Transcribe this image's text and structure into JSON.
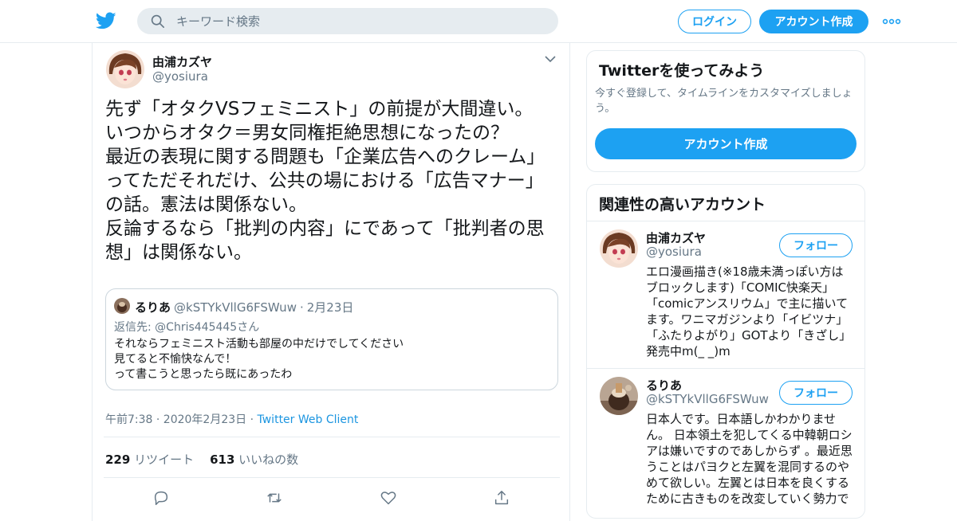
{
  "header": {
    "search_placeholder": "キーワード検索",
    "login_label": "ログイン",
    "signup_label": "アカウント作成",
    "brand_color": "#1da1f2"
  },
  "tweet": {
    "author_name": "由浦カズヤ",
    "author_handle": "@yosiura",
    "text_lines": [
      "先ず「オタクVSフェミニスト」の前提が大間違い。",
      "いつからオタク＝男女同権拒絶思想になったの？",
      "最近の表現に関する問題も「企業広告へのクレーム」",
      "ってただそれだけ、公共の場における「広告マナー」",
      "の話。憲法は関係ない。",
      "反論するなら「批判の内容」にであって「批判者の思",
      "想」は関係ない。"
    ],
    "quote": {
      "name": "るりあ",
      "handle": "@kSTYkVllG6FSWuw",
      "dot": "·",
      "date": "2月23日",
      "reply_prefix": "返信先: ",
      "reply_mention": "@Chris445445さん",
      "body_lines": [
        "それならフェミニスト活動も部屋の中だけでしてください",
        "見てると不愉快なんで！",
        "って書こうと思ったら既にあったわ"
      ]
    },
    "timestamp": "午前7:38 · 2020年2月23日 · ",
    "client": "Twitter Web Client",
    "retweet_count": "229",
    "retweet_label": " リツイート",
    "like_count": "613",
    "like_label": " いいねの数"
  },
  "sidebar": {
    "signup_card": {
      "title": "Twitterを使ってみよう",
      "subtitle": "今すぐ登録して、タイムラインをカスタマイズしましょう。",
      "button_label": "アカウント作成"
    },
    "related": {
      "title": "関連性の高いアカウント",
      "follow_label": "フォロー",
      "accounts": [
        {
          "name": "由浦カズヤ",
          "handle": "@yosiura",
          "bio_lines": [
            "エロ漫画描き(※18歳未満っぽい方は",
            "ブロックします)「COMIC快楽天」",
            "「comicアンスリウム」で主に描いて",
            "ます。ワニマガジンより「イビツナ」",
            "「ふたりよがり」GOTより「きざし」",
            "発売中m(_ _)m"
          ]
        },
        {
          "name": "るりあ",
          "handle": "@kSTYkVllG6FSWuw",
          "bio_lines": [
            "日本人です。日本語しかわかりませ",
            "ん。 日本領土を犯してくる中韓朝ロシ",
            "アは嫌いですのであしからず 。最近思",
            "うことはパヨクと左翼を混同するのや",
            "めて欲しい。左翼とは日本を良くする",
            "ために古きものを改変していく勢力で"
          ]
        }
      ]
    }
  }
}
